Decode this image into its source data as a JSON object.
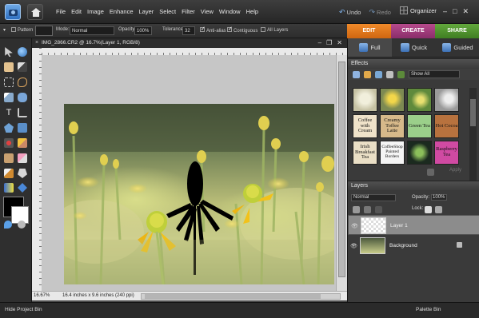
{
  "menubar": {
    "menus": [
      "File",
      "Edit",
      "Image",
      "Enhance",
      "Layer",
      "Select",
      "Filter",
      "View",
      "Window",
      "Help"
    ],
    "undo_label": "Undo",
    "redo_label": "Redo",
    "organizer_label": "Organizer"
  },
  "options": {
    "pattern_label": "Pattern",
    "mode_label": "Mode:",
    "mode_value": "Normal",
    "opacity_label": "Opacity:",
    "opacity_value": "100%",
    "tolerance_label": "Tolerance:",
    "tolerance_value": "32",
    "antialias_label": "Anti-alias",
    "contiguous_label": "Contiguous",
    "all_layers_label": "All Layers"
  },
  "mode_tabs": {
    "edit": "EDIT",
    "create": "CREATE",
    "share": "SHARE"
  },
  "document": {
    "title": "IMG_2866.CR2 @ 16.7%(Layer 1, RGB/8)",
    "zoom": "16.67%",
    "info": "16.4 inches x 9.6 inches (240 ppi)"
  },
  "panel": {
    "subtabs": [
      "Full",
      "Quick",
      "Guided"
    ],
    "effects_title": "Effects",
    "effects_filter": "Show All",
    "effects_items": [
      {
        "label": "",
        "bg": "#c6c2a4"
      },
      {
        "label": "",
        "bg": "#7d8a52"
      },
      {
        "label": "",
        "bg": "#5f8a3c"
      },
      {
        "label": "",
        "bg": "#9a9a9a"
      },
      {
        "label": "Coffee with Cream",
        "bg": "#efe2c9"
      },
      {
        "label": "Creamy Toffee Latte",
        "bg": "#d7b98a"
      },
      {
        "label": "Green Tea",
        "bg": "#9bcf8a"
      },
      {
        "label": "Hot Cocoa",
        "bg": "#b8723e"
      },
      {
        "label": "Irish Breakfast Tea",
        "bg": "#eadfc6"
      },
      {
        "label": "CoffeeShop Painted Borders",
        "bg": "#f4f4f4"
      },
      {
        "label": "",
        "bg": "#1b2a1f"
      },
      {
        "label": "Raspberry Tea",
        "bg": "#d04aa2"
      }
    ],
    "apply_label": "Apply",
    "layers_title": "Layers",
    "layers_mode": "Normal",
    "layers_opacity_label": "Opacity:",
    "layers_opacity_value": "100%",
    "lock_label": "Lock:",
    "layers": [
      {
        "name": "Layer 1",
        "selected": true
      },
      {
        "name": "Background",
        "selected": false
      }
    ]
  },
  "bottombar": {
    "hide_bin": "Hide Project Bin",
    "palette_bin": "Palette Bin"
  }
}
